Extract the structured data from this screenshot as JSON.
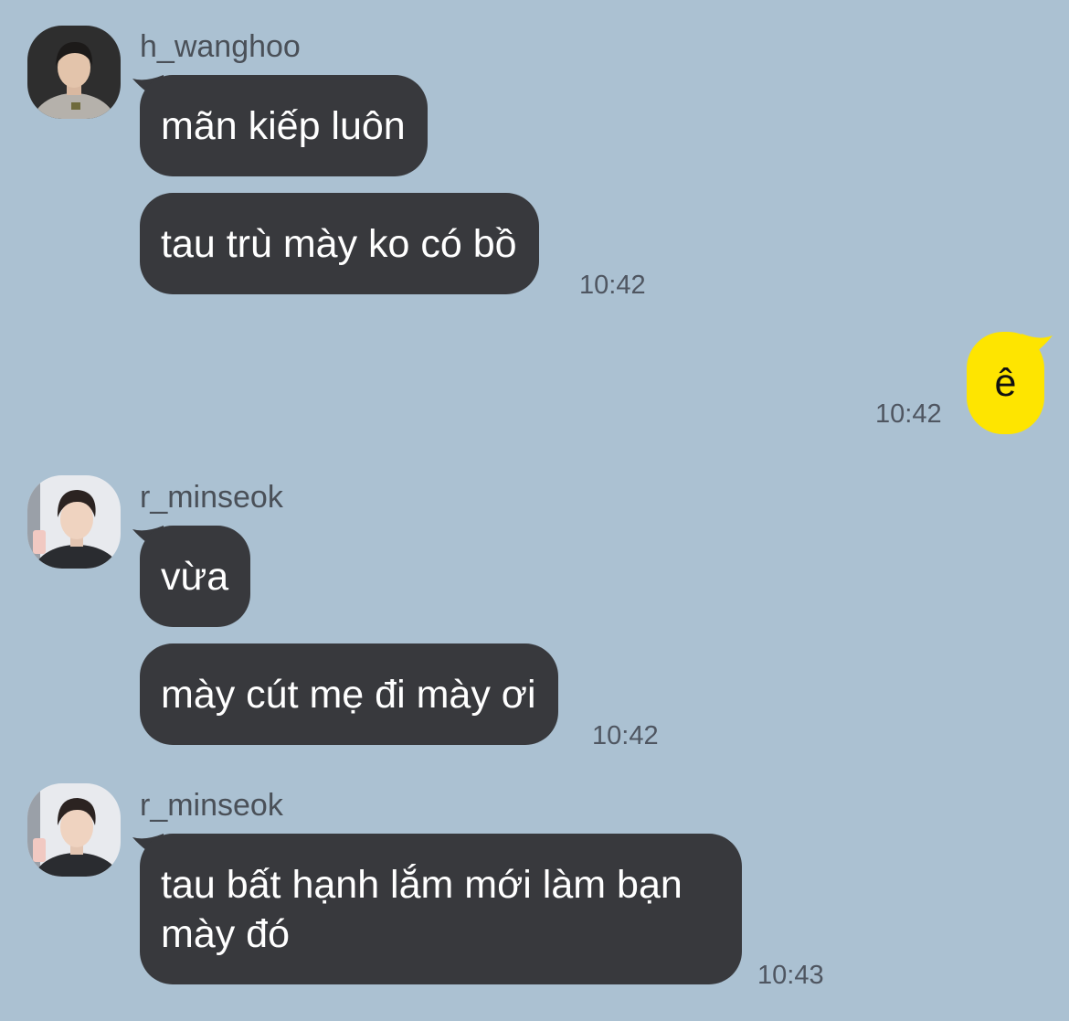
{
  "messages": [
    {
      "sender": "h_wanghoo",
      "avatar": "avatar-h-wanghoo",
      "bubbles": [
        "mãn kiếp luôn",
        "tau trù mày ko có bồ"
      ],
      "time": "10:42"
    },
    {
      "sender": "me",
      "bubbles": [
        "ê"
      ],
      "time": "10:42"
    },
    {
      "sender": "r_minseok",
      "avatar": "avatar-r-minseok",
      "bubbles": [
        "vừa",
        "mày cút mẹ đi mày ơi"
      ],
      "time": "10:42"
    },
    {
      "sender": "r_minseok",
      "avatar": "avatar-r-minseok",
      "bubbles": [
        "tau bất hạnh lắm mới làm bạn mày đó"
      ],
      "time": "10:43"
    }
  ],
  "colors": {
    "background": "#abc1d2",
    "incoming_bubble": "#38393d",
    "outgoing_bubble": "#fee500",
    "timestamp": "#4f5661",
    "sender_name": "#4a5058"
  }
}
